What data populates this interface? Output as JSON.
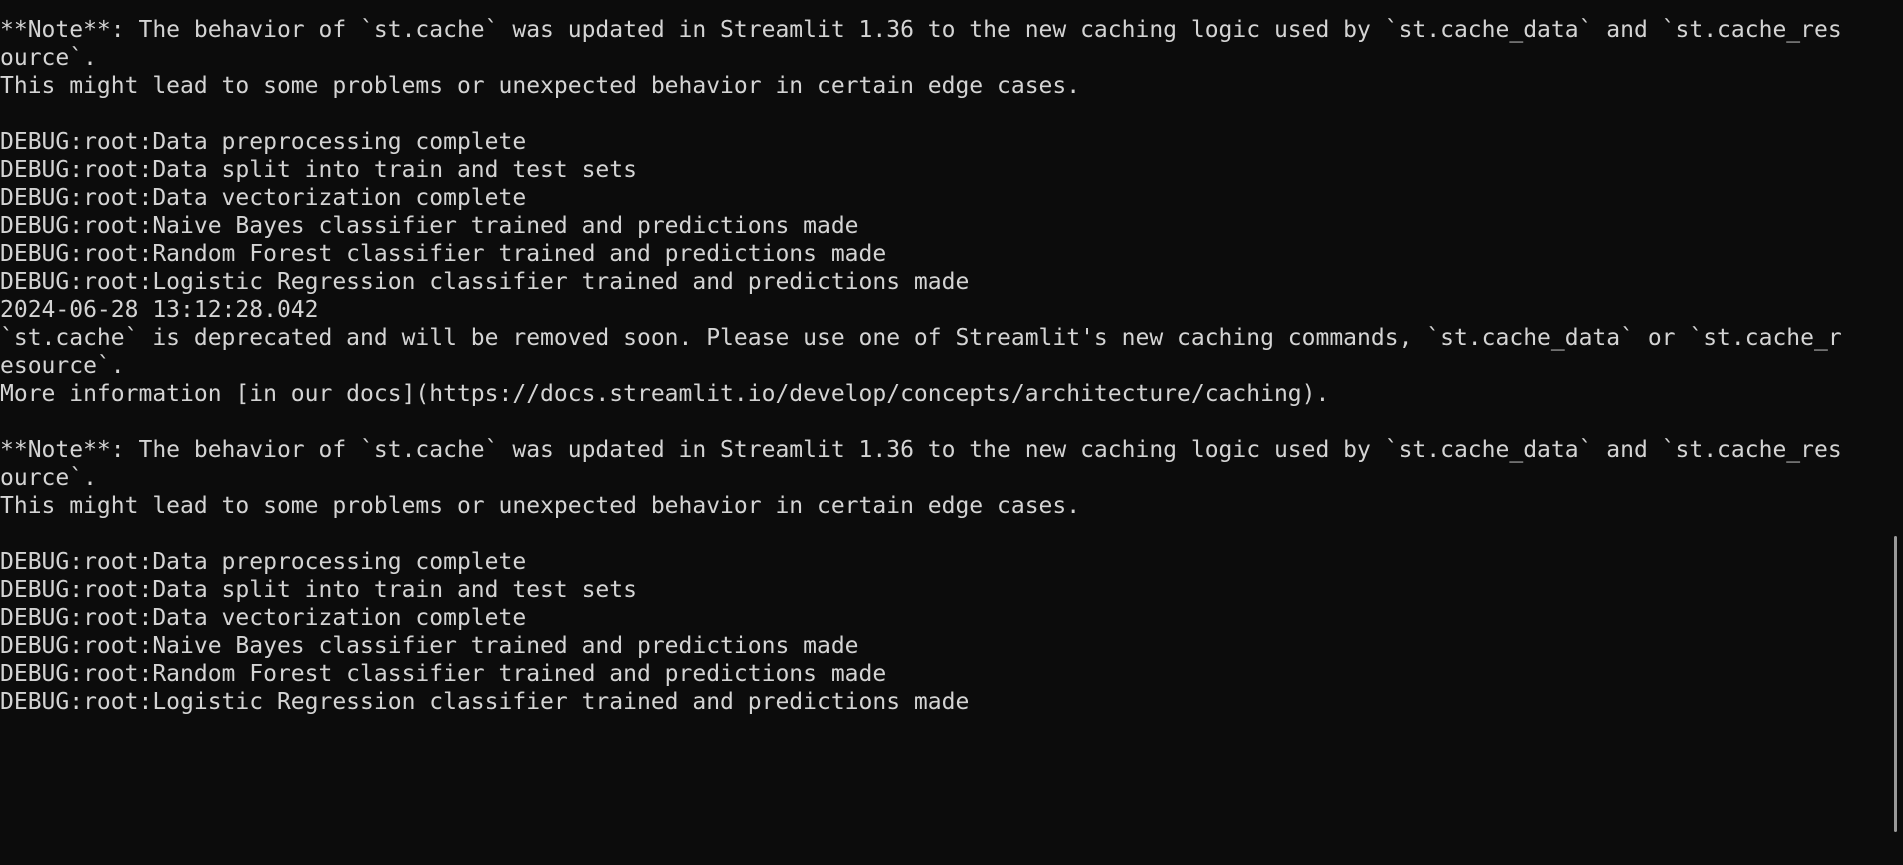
{
  "terminal": {
    "lines": [
      "**Note**: The behavior of `st.cache` was updated in Streamlit 1.36 to the new caching logic used by `st.cache_data` and `st.cache_res",
      "ource`.",
      "This might lead to some problems or unexpected behavior in certain edge cases.",
      "",
      "DEBUG:root:Data preprocessing complete",
      "DEBUG:root:Data split into train and test sets",
      "DEBUG:root:Data vectorization complete",
      "DEBUG:root:Naive Bayes classifier trained and predictions made",
      "DEBUG:root:Random Forest classifier trained and predictions made",
      "DEBUG:root:Logistic Regression classifier trained and predictions made",
      "2024-06-28 13:12:28.042",
      "`st.cache` is deprecated and will be removed soon. Please use one of Streamlit's new caching commands, `st.cache_data` or `st.cache_r",
      "esource`.",
      "More information [in our docs](https://docs.streamlit.io/develop/concepts/architecture/caching).",
      "",
      "**Note**: The behavior of `st.cache` was updated in Streamlit 1.36 to the new caching logic used by `st.cache_data` and `st.cache_res",
      "ource`.",
      "This might lead to some problems or unexpected behavior in certain edge cases.",
      "",
      "DEBUG:root:Data preprocessing complete",
      "DEBUG:root:Data split into train and test sets",
      "DEBUG:root:Data vectorization complete",
      "DEBUG:root:Naive Bayes classifier trained and predictions made",
      "DEBUG:root:Random Forest classifier trained and predictions made",
      "DEBUG:root:Logistic Regression classifier trained and predictions made"
    ]
  },
  "colors": {
    "background": "#0c0c0c",
    "text": "#d4d4d4",
    "scrollbar_thumb": "#9a9a9a"
  }
}
